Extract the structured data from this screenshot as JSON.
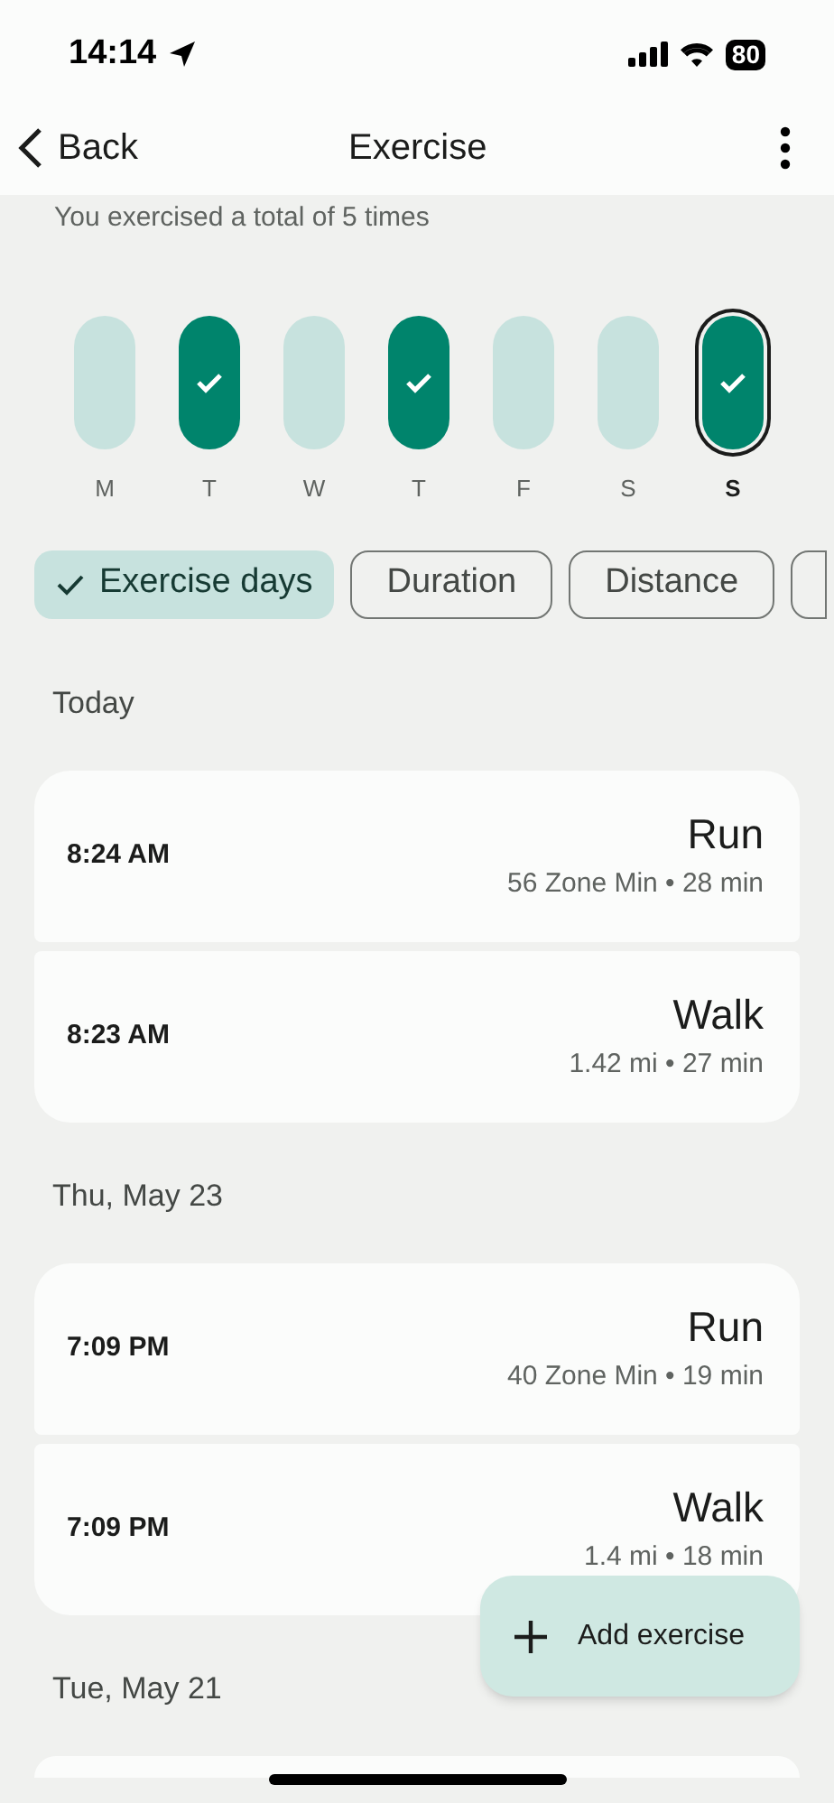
{
  "status_bar": {
    "time": "14:14",
    "battery": "80"
  },
  "header": {
    "back": "Back",
    "title": "Exercise"
  },
  "summary": "You exercised a total of 5 times",
  "days": [
    {
      "label": "M",
      "exercised": false,
      "selected": false
    },
    {
      "label": "T",
      "exercised": true,
      "selected": false
    },
    {
      "label": "W",
      "exercised": false,
      "selected": false
    },
    {
      "label": "T",
      "exercised": true,
      "selected": false
    },
    {
      "label": "F",
      "exercised": false,
      "selected": false
    },
    {
      "label": "S",
      "exercised": false,
      "selected": false
    },
    {
      "label": "S",
      "exercised": true,
      "selected": true
    }
  ],
  "chips": [
    {
      "label": "Exercise days",
      "selected": true
    },
    {
      "label": "Duration",
      "selected": false
    },
    {
      "label": "Distance",
      "selected": false
    }
  ],
  "groups": [
    {
      "date": "Today",
      "entries": [
        {
          "time": "8:24 AM",
          "activity": "Run",
          "details": "56 Zone Min • 28 min"
        },
        {
          "time": "8:23 AM",
          "activity": "Walk",
          "details": "1.42 mi • 27 min"
        }
      ]
    },
    {
      "date": "Thu, May 23",
      "entries": [
        {
          "time": "7:09 PM",
          "activity": "Run",
          "details": "40 Zone Min • 19 min"
        },
        {
          "time": "7:09 PM",
          "activity": "Walk",
          "details": "1.4 mi • 18 min"
        }
      ]
    },
    {
      "date": "Tue, May 21"
    }
  ],
  "fab": {
    "label": "Add exercise"
  }
}
